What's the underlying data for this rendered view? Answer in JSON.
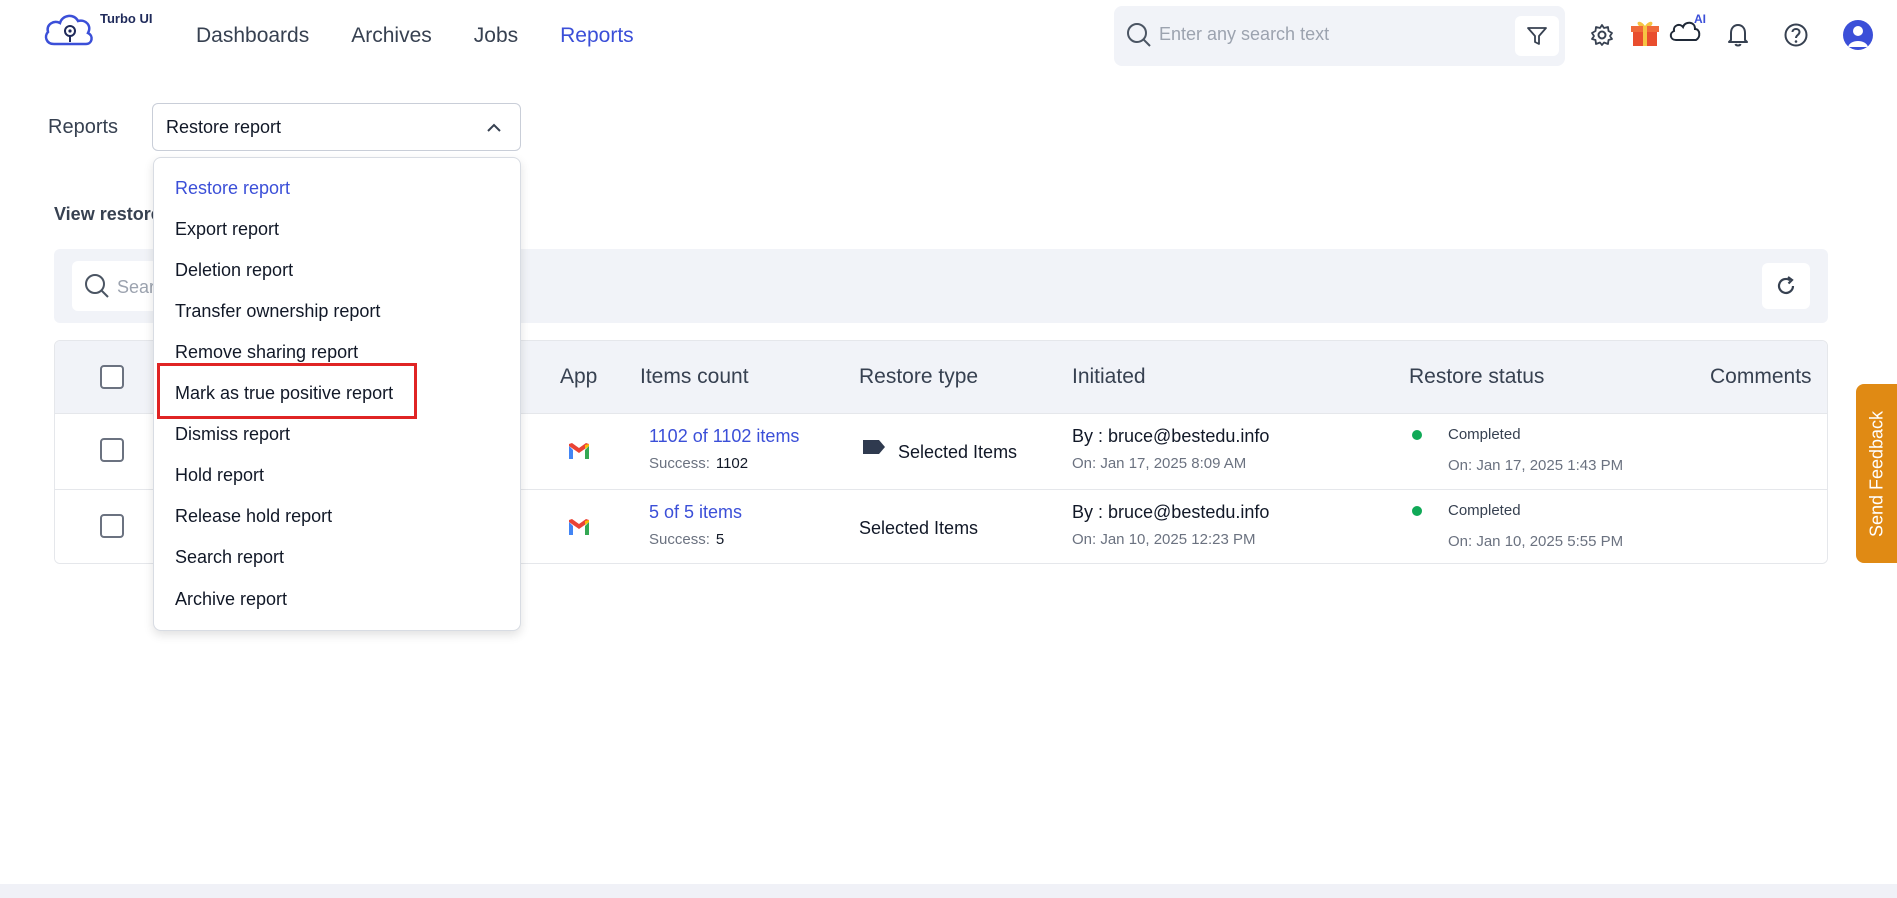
{
  "app": {
    "name": "Turbo UI"
  },
  "nav": {
    "items": [
      {
        "label": "Dashboards",
        "active": false
      },
      {
        "label": "Archives",
        "active": false
      },
      {
        "label": "Jobs",
        "active": false
      },
      {
        "label": "Reports",
        "active": true
      }
    ]
  },
  "search": {
    "placeholder": "Enter any search text"
  },
  "header_icons": {
    "ai_badge": "AI"
  },
  "reports": {
    "label": "Reports",
    "selected": "Restore report",
    "options": [
      "Restore report",
      "Export report",
      "Deletion report",
      "Transfer ownership report",
      "Remove sharing report",
      "Mark as true positive report",
      "Dismiss report",
      "Hold report",
      "Release hold report",
      "Search report",
      "Archive report"
    ],
    "highlighted_option": "Mark as true positive report"
  },
  "view_title_partial": "View restore",
  "table_search": {
    "placeholder_partial": "Sear"
  },
  "table": {
    "headers": [
      "App",
      "Items count",
      "Restore type",
      "Initiated",
      "Restore status",
      "Comments"
    ],
    "rows": [
      {
        "app": "gmail",
        "items_count": "1102 of 1102 items",
        "success_label": "Success:",
        "success_value": "1102",
        "restore_type": "Selected Items",
        "initiated_by": "By : bruce@bestedu.info",
        "initiated_on": "On: Jan 17, 2025 8:09 AM",
        "status": "Completed",
        "status_on": "On: Jan 17, 2025 1:43 PM"
      },
      {
        "app": "gmail",
        "items_count": "5 of 5 items",
        "success_label": "Success:",
        "success_value": "5",
        "restore_type": "Selected Items",
        "initiated_by": "By : bruce@bestedu.info",
        "initiated_on": "On: Jan 10, 2025 12:23 PM",
        "status": "Completed",
        "status_on": "On: Jan 10, 2025 5:55 PM"
      }
    ]
  },
  "feedback": {
    "label": "Send Feedback"
  },
  "colors": {
    "accent": "#3b4fd8",
    "success": "#10a957",
    "feedback": "#e08a14",
    "highlight": "#e02424"
  }
}
